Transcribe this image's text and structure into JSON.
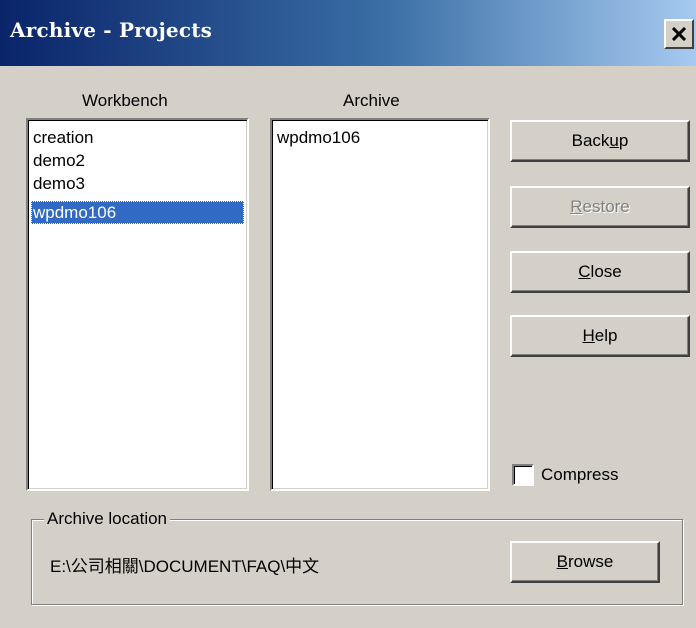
{
  "window": {
    "title": "Archive - Projects",
    "close_symbol": "×"
  },
  "workbench": {
    "header": "Workbench",
    "items": [
      "creation",
      "demo2",
      "demo3",
      "wpdmo106"
    ],
    "selected": "wpdmo106"
  },
  "archive": {
    "header": "Archive",
    "items": [
      "wpdmo106"
    ]
  },
  "buttons": {
    "backup": {
      "pre": "Back",
      "accel": "u",
      "post": "p"
    },
    "restore": {
      "pre": "",
      "accel": "R",
      "post": "estore"
    },
    "close": {
      "pre": "",
      "accel": "C",
      "post": "lose"
    },
    "help": {
      "pre": "",
      "accel": "H",
      "post": "elp"
    },
    "browse": {
      "pre": "",
      "accel": "B",
      "post": "rowse"
    }
  },
  "compress": {
    "label": "Compress",
    "checked": false
  },
  "location": {
    "legend": "Archive location",
    "path": "E:\\公司相關\\DOCUMENT\\FAQ\\中文"
  },
  "colors": {
    "title_bar_start": "#0a246a",
    "title_bar_end": "#a6caf0",
    "selection": "#316ac5",
    "face": "#d4d0c8"
  }
}
